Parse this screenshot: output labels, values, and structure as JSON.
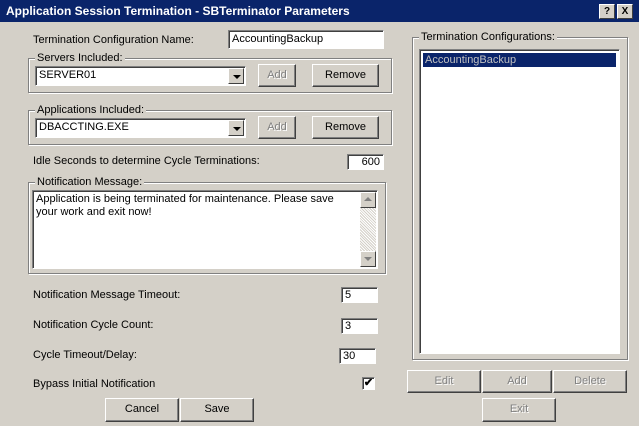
{
  "window": {
    "title": "Application Session Termination - SBTerminator Parameters",
    "help_glyph": "?",
    "close_glyph": "X"
  },
  "config_name": {
    "label": "Termination Configuration Name:",
    "value": "AccountingBackup"
  },
  "servers": {
    "legend": "Servers Included:",
    "selected": "SERVER01",
    "add_label": "Add",
    "remove_label": "Remove"
  },
  "applications": {
    "legend": "Applications Included:",
    "selected": "DBACCTING.EXE",
    "add_label": "Add",
    "remove_label": "Remove"
  },
  "idle_seconds": {
    "label": "Idle Seconds to determine Cycle Terminations:",
    "value": "600"
  },
  "notification_message": {
    "legend": "Notification Message:",
    "text": "Application is being terminated for maintenance. Please save your work and exit now!"
  },
  "notification_timeout": {
    "label": "Notification Message Timeout:",
    "value": "5"
  },
  "notification_cycle_count": {
    "label": "Notification Cycle Count:",
    "value": "3"
  },
  "cycle_timeout": {
    "label": "Cycle Timeout/Delay:",
    "value": "30"
  },
  "bypass": {
    "label": "Bypass Initial Notification",
    "checked": true,
    "check_glyph": "✔"
  },
  "footer": {
    "cancel_label": "Cancel",
    "save_label": "Save"
  },
  "configurations": {
    "legend": "Termination Configurations:",
    "items": [
      "AccountingBackup"
    ],
    "edit_label": "Edit",
    "add_label": "Add",
    "delete_label": "Delete",
    "exit_label": "Exit"
  }
}
